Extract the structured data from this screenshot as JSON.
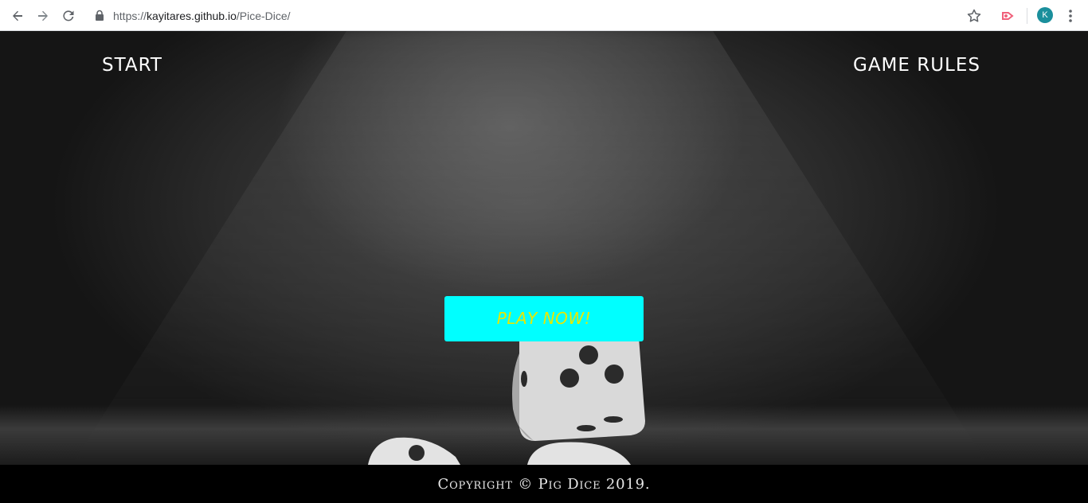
{
  "browser": {
    "url_scheme": "https://",
    "url_domain": "kayitares.github.io",
    "url_path": "/Pice-Dice/",
    "profile_initial": "K",
    "icons": {
      "back": "arrow-left-icon",
      "forward": "arrow-right-icon",
      "reload": "reload-icon",
      "lock": "lock-icon",
      "bookmark": "star-icon",
      "extension": "extension-icon",
      "menu": "more-vert-icon"
    }
  },
  "nav": {
    "start_label": "START",
    "rules_label": "GAME RULES"
  },
  "hero": {
    "cta_label": "PLAY NOW!",
    "cta_bg_color": "#00ffff",
    "cta_text_color": "#e8e800"
  },
  "footer": {
    "copyright": "Copyright © Pig Dice 2019."
  }
}
